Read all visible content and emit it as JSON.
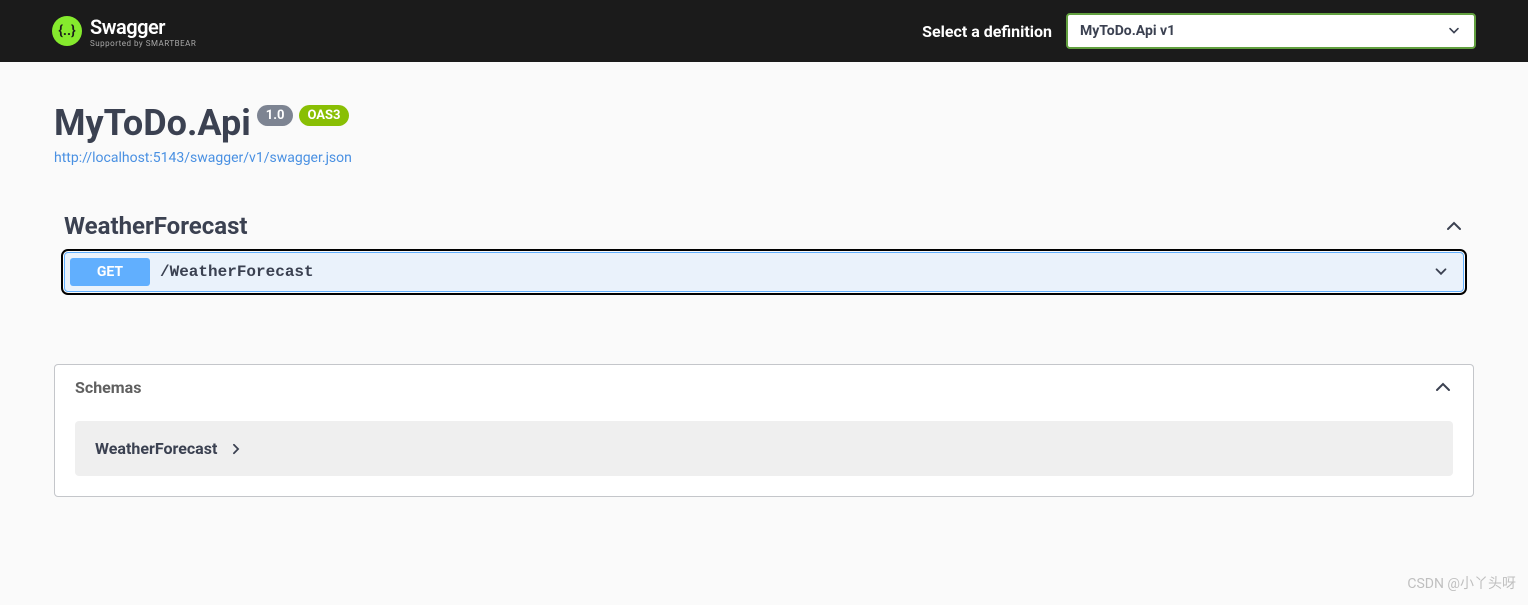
{
  "topbar": {
    "brand": "Swagger",
    "brand_sub": "Supported by SMARTBEAR",
    "select_label": "Select a definition",
    "selected_definition": "MyToDo.Api v1"
  },
  "info": {
    "title": "MyToDo.Api",
    "version": "1.0",
    "oas_badge": "OAS3",
    "spec_url": "http://localhost:5143/swagger/v1/swagger.json"
  },
  "tags": [
    {
      "name": "WeatherForecast",
      "operations": [
        {
          "method": "GET",
          "path": "/WeatherForecast"
        }
      ]
    }
  ],
  "schemas": {
    "title": "Schemas",
    "items": [
      {
        "name": "WeatherForecast"
      }
    ]
  },
  "watermark": "CSDN @小丫头呀"
}
